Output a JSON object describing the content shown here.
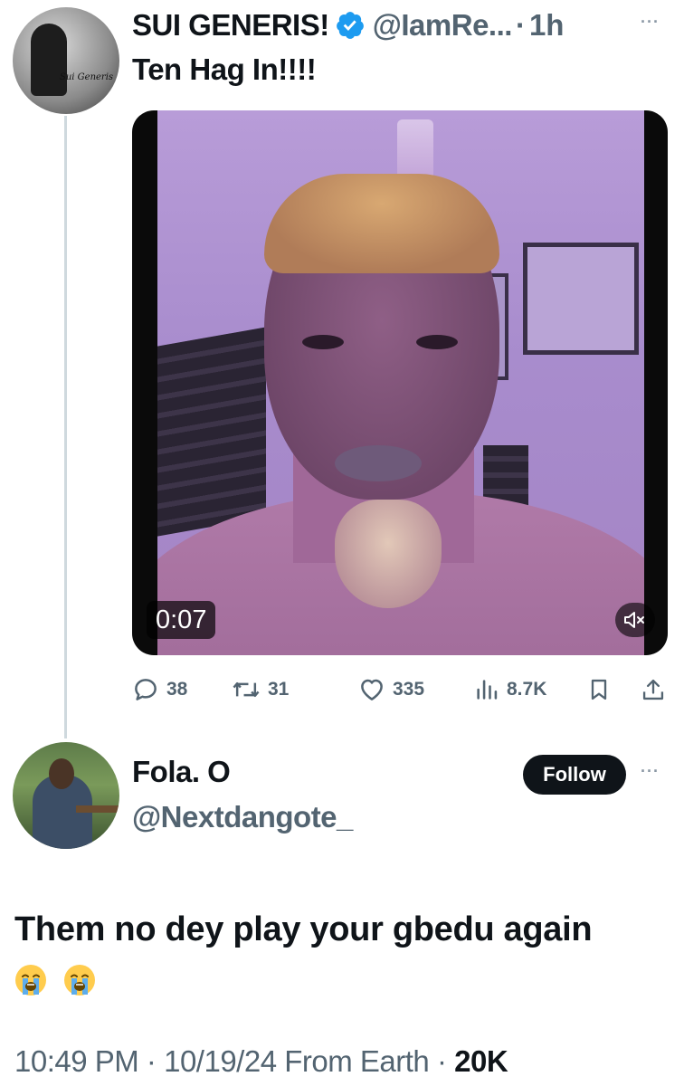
{
  "parent_tweet": {
    "display_name": "SUI GENERIS!",
    "handle": "@IamRe...",
    "separator": "·",
    "time_ago": "1h",
    "more": "···",
    "text": "Ten Hag In!!!!",
    "avatar_brand": "Sui Generis",
    "video": {
      "duration": "0:07"
    },
    "actions": {
      "replies": "38",
      "retweets": "31",
      "likes": "335",
      "views": "8.7K"
    }
  },
  "reply_tweet": {
    "display_name": "Fola. O",
    "handle": "@Nextdangote_",
    "follow_label": "Follow",
    "more": "···",
    "text": "Them no dey play your gbedu again",
    "emojis": [
      "loudly-crying-face",
      "loudly-crying-face"
    ],
    "time": "10:49 PM",
    "separator": "·",
    "date": "10/19/24",
    "source": "From Earth",
    "views": "20K"
  },
  "colors": {
    "text_primary": "#0f1419",
    "text_secondary": "#536471",
    "verified": "#1d9bf0",
    "thread_line": "#cfd9de"
  }
}
